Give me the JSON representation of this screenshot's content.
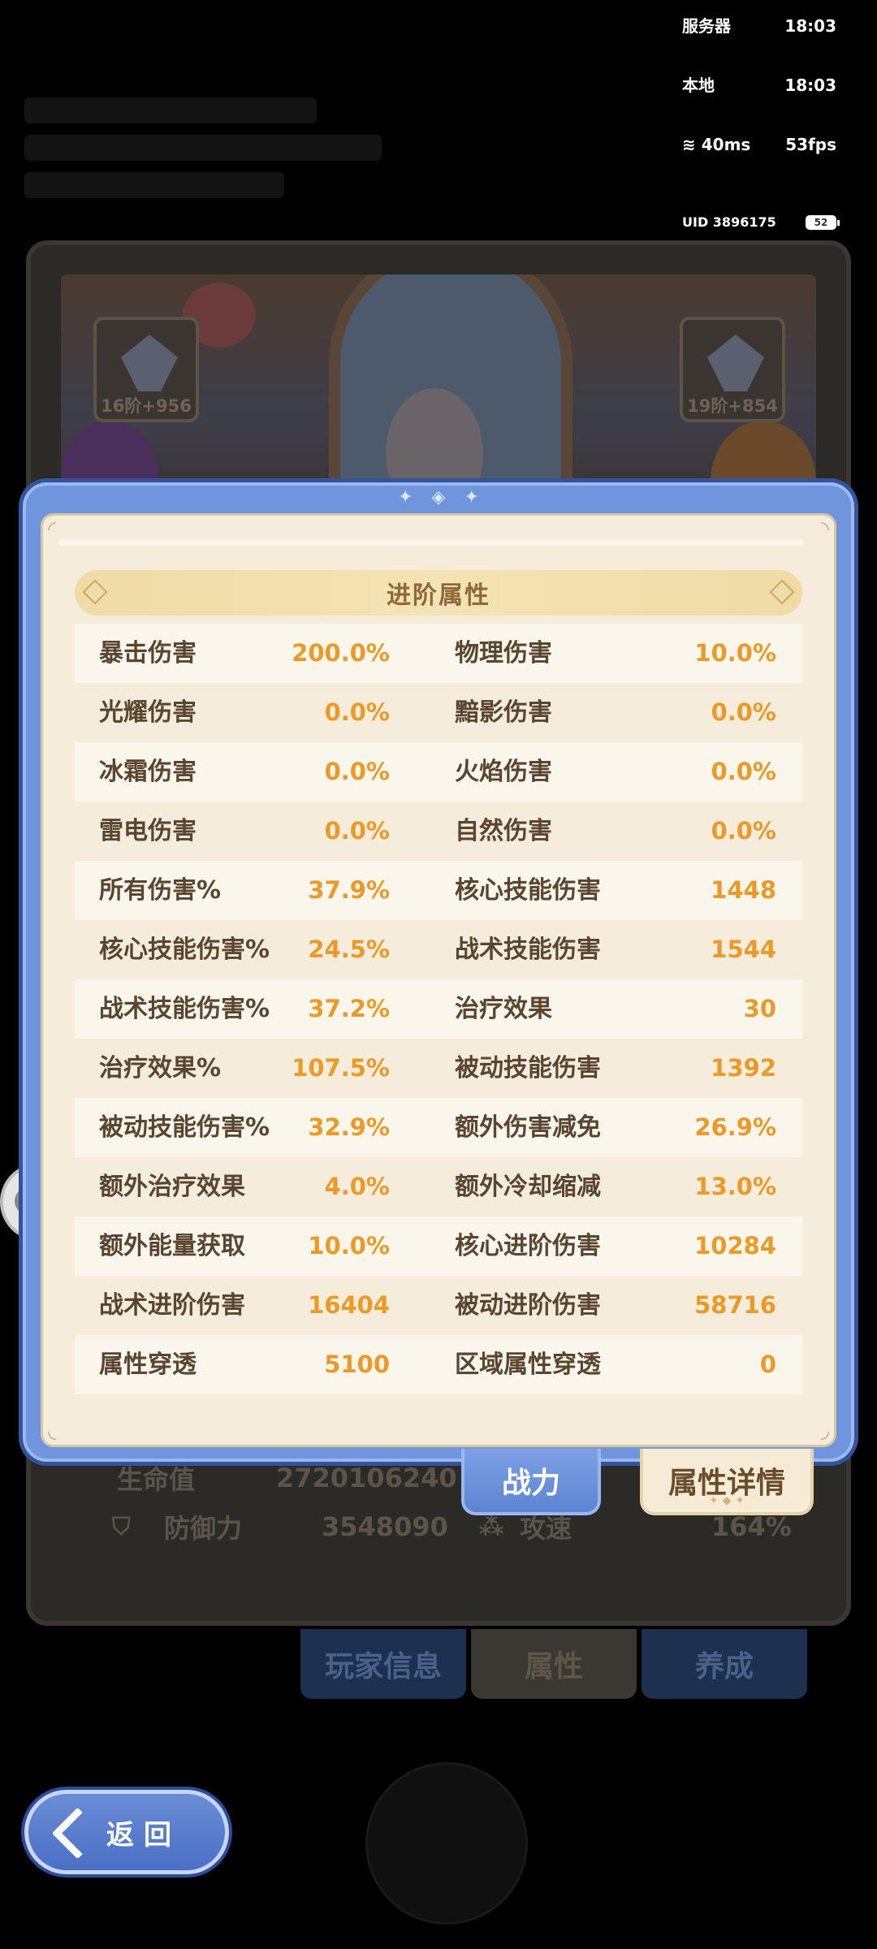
{
  "status": {
    "server_label": "服务器",
    "server_time": "18:03",
    "local_label": "本地",
    "local_time": "18:03",
    "ping": "40ms",
    "fps": "53fps",
    "uid": "UID 3896175",
    "battery": "52"
  },
  "banner": {
    "left_gear_label": "16阶+956",
    "right_gear_label": "19阶+854"
  },
  "under_stats": {
    "hp_label": "生命值",
    "hp_value": "2720106240",
    "def_label": "防御力",
    "def_value": "3548090",
    "speed_label": "攻速",
    "speed_value": "164%"
  },
  "bottom_tabs": {
    "player": "玩家信息",
    "attr": "属性",
    "grow": "养成"
  },
  "back_button": {
    "label": "返回"
  },
  "modal": {
    "section_title": "进阶属性",
    "rows": [
      [
        {
          "name": "暴击伤害",
          "value": "200.0%"
        },
        {
          "name": "物理伤害",
          "value": "10.0%"
        }
      ],
      [
        {
          "name": "光耀伤害",
          "value": "0.0%"
        },
        {
          "name": "黯影伤害",
          "value": "0.0%"
        }
      ],
      [
        {
          "name": "冰霜伤害",
          "value": "0.0%"
        },
        {
          "name": "火焰伤害",
          "value": "0.0%"
        }
      ],
      [
        {
          "name": "雷电伤害",
          "value": "0.0%"
        },
        {
          "name": "自然伤害",
          "value": "0.0%"
        }
      ],
      [
        {
          "name": "所有伤害%",
          "value": "37.9%"
        },
        {
          "name": "核心技能伤害",
          "value": "1448"
        }
      ],
      [
        {
          "name": "核心技能伤害%",
          "value": "24.5%"
        },
        {
          "name": "战术技能伤害",
          "value": "1544"
        }
      ],
      [
        {
          "name": "战术技能伤害%",
          "value": "37.2%"
        },
        {
          "name": "治疗效果",
          "value": "30"
        }
      ],
      [
        {
          "name": "治疗效果%",
          "value": "107.5%"
        },
        {
          "name": "被动技能伤害",
          "value": "1392"
        }
      ],
      [
        {
          "name": "被动技能伤害%",
          "value": "32.9%"
        },
        {
          "name": "额外伤害减免",
          "value": "26.9%"
        }
      ],
      [
        {
          "name": "额外治疗效果",
          "value": "4.0%"
        },
        {
          "name": "额外冷却缩减",
          "value": "13.0%"
        }
      ],
      [
        {
          "name": "额外能量获取",
          "value": "10.0%"
        },
        {
          "name": "核心进阶伤害",
          "value": "10284"
        }
      ],
      [
        {
          "name": "战术进阶伤害",
          "value": "16404"
        },
        {
          "name": "被动进阶伤害",
          "value": "58716"
        }
      ],
      [
        {
          "name": "属性穿透",
          "value": "5100"
        },
        {
          "name": "区域属性穿透",
          "value": "0"
        }
      ]
    ],
    "tab_power": "战力",
    "tab_detail": "属性详情"
  }
}
